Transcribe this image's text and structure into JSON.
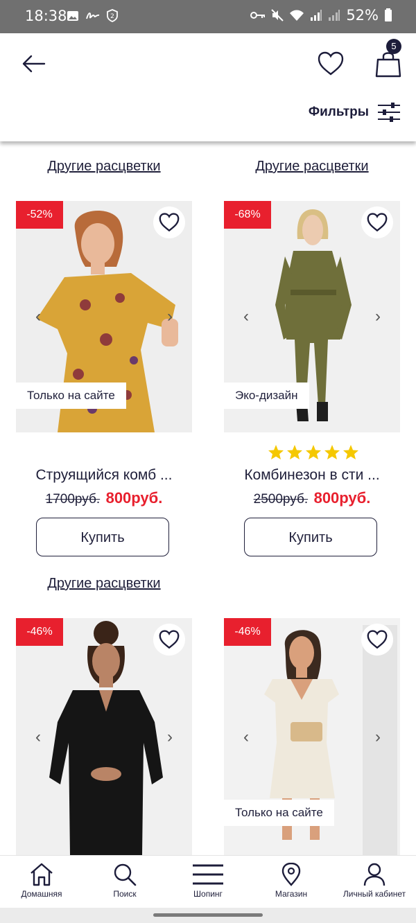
{
  "status_bar": {
    "time": "18:38",
    "battery": "52%"
  },
  "header": {
    "cart_count": "5",
    "filters_label": "Фильтры"
  },
  "other_colors_label": "Другие расцветки",
  "products": [
    {
      "discount": "-52%",
      "tag": "Только на сайте",
      "title": "Струящийся комб ...",
      "old_price": "1700руб.",
      "new_price": "800руб.",
      "buy_label": "Купить",
      "rating_stars": 0,
      "image_colors": {
        "bg": "#eeeeee",
        "main": "#d9a437",
        "accent": "#8f3b3b",
        "skin": "#e9b99a",
        "hair": "#b86b3a"
      }
    },
    {
      "discount": "-68%",
      "tag": "Эко-дизайн",
      "title": "Комбинезон в сти ...",
      "old_price": "2500руб.",
      "new_price": "800руб.",
      "buy_label": "Купить",
      "rating_stars": 5,
      "image_colors": {
        "bg": "#f0f0f0",
        "main": "#6f6f3a",
        "accent": "#3a3a2a",
        "skin": "#eccbb0",
        "hair": "#d9bf84"
      }
    },
    {
      "discount": "-46%",
      "tag": "",
      "title": "",
      "old_price": "",
      "new_price": "",
      "buy_label": "",
      "rating_stars": 0,
      "image_colors": {
        "bg": "#f0f0f0",
        "main": "#151515",
        "accent": "#2a2a2a",
        "skin": "#b98466",
        "hair": "#3a2418"
      }
    },
    {
      "discount": "-46%",
      "tag": "Только на сайте",
      "title": "",
      "old_price": "",
      "new_price": "",
      "buy_label": "",
      "rating_stars": 0,
      "image_colors": {
        "bg": "#f2f2f2",
        "main": "#efe9dc",
        "accent": "#d8b98a",
        "skin": "#d9a07c",
        "hair": "#3b2a1f"
      }
    }
  ],
  "bottom_nav": [
    {
      "label": "Домашняя",
      "icon": "home-icon"
    },
    {
      "label": "Поиск",
      "icon": "search-icon"
    },
    {
      "label": "Шопинг",
      "icon": "menu-icon"
    },
    {
      "label": "Магазин",
      "icon": "location-pin-icon"
    },
    {
      "label": "Личный кабинет",
      "icon": "user-icon"
    }
  ],
  "colors": {
    "accent_red": "#e8202e",
    "navy": "#1c1c3a",
    "star_yellow": "#f5c800"
  }
}
